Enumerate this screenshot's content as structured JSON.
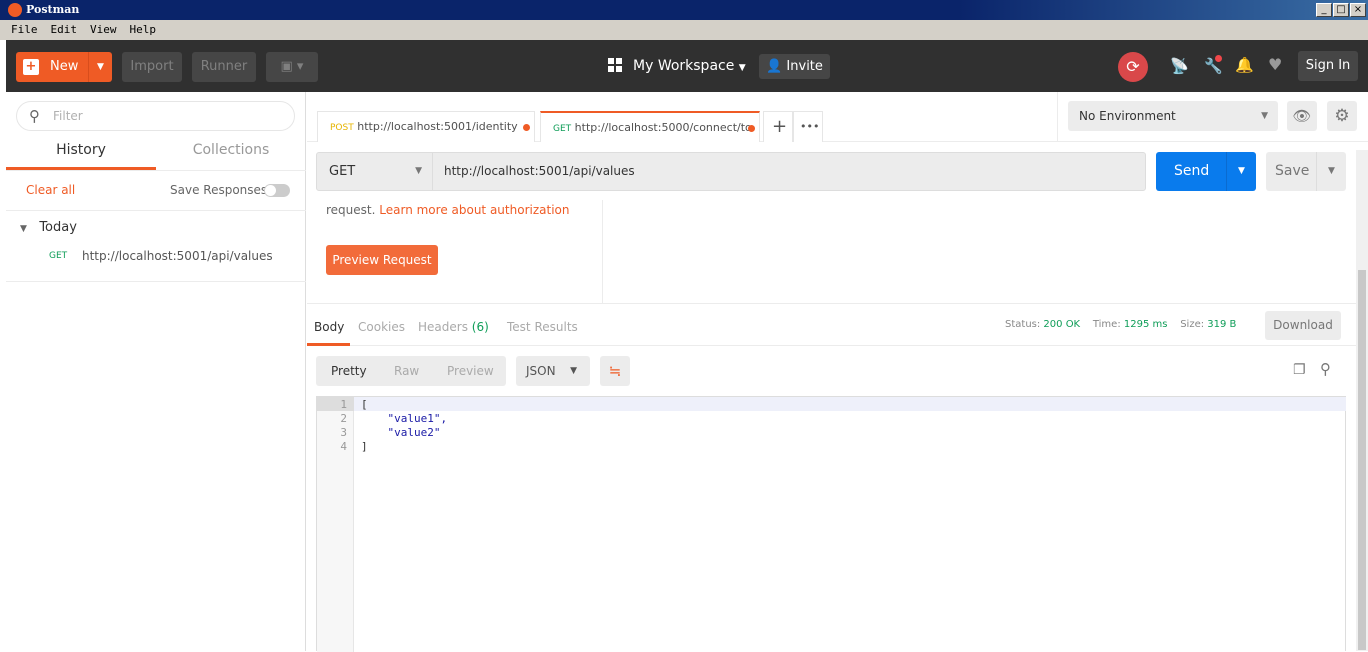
{
  "window": {
    "title": "Postman",
    "menu": [
      "File",
      "Edit",
      "View",
      "Help"
    ]
  },
  "header": {
    "new_label": "New",
    "import_label": "Import",
    "runner_label": "Runner",
    "workspace_label": "My Workspace",
    "invite_label": "Invite",
    "signin_label": "Sign In",
    "accent": "#ef5b25"
  },
  "sidebar": {
    "filter_placeholder": "Filter",
    "tabs": [
      "History",
      "Collections"
    ],
    "clear_all": "Clear all",
    "save_responses": "Save Responses",
    "save_responses_on": false,
    "group": "Today",
    "items": [
      {
        "method": "GET",
        "url": "http://localhost:5001/api/values"
      }
    ]
  },
  "tabs": [
    {
      "method": "POST",
      "url": "http://localhost:5001/identity"
    },
    {
      "method": "GET",
      "url": "http://localhost:5000/connect/to"
    }
  ],
  "environment": {
    "selected": "No Environment"
  },
  "request": {
    "method": "GET",
    "url": "http://localhost:5001/api/values",
    "send_label": "Send",
    "save_label": "Save",
    "auth_text": "request.",
    "auth_link": "Learn more about authorization",
    "preview_label": "Preview Request"
  },
  "response": {
    "tabs": [
      "Body",
      "Cookies",
      "Headers",
      "Test Results"
    ],
    "headers_count": "(6)",
    "status_label": "Status:",
    "status": "200 OK",
    "time_label": "Time:",
    "time": "1295 ms",
    "size_label": "Size:",
    "size": "319 B",
    "download_label": "Download",
    "views": [
      "Pretty",
      "Raw",
      "Preview"
    ],
    "format": "JSON",
    "lines": [
      {
        "n": "1",
        "text": "["
      },
      {
        "n": "2",
        "text": "    \"value1\","
      },
      {
        "n": "3",
        "text": "    \"value2\""
      },
      {
        "n": "4",
        "text": "]"
      }
    ]
  }
}
